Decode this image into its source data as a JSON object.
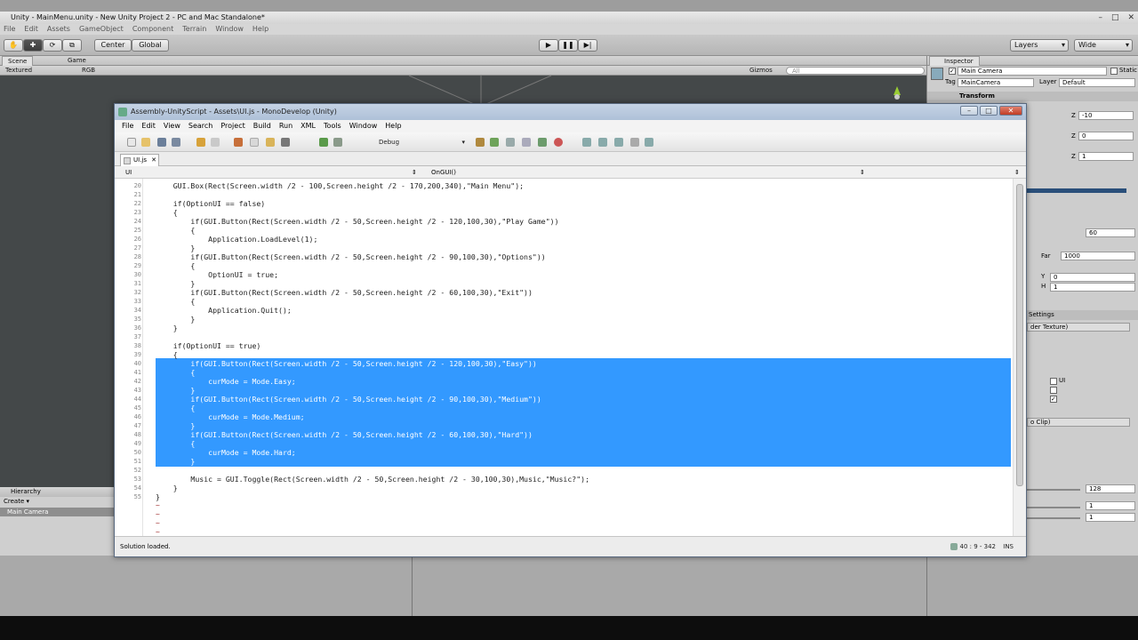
{
  "unity": {
    "window_title": "Unity - MainMenu.unity - New Unity Project 2 - PC and Mac Standalone*",
    "menu": [
      "File",
      "Edit",
      "Assets",
      "GameObject",
      "Component",
      "Terrain",
      "Window",
      "Help"
    ],
    "toolbar": {
      "center": "Center",
      "global": "Global",
      "layers": "Layers",
      "layout": "Wide"
    },
    "scene_tab": "Scene",
    "game_tab": "Game",
    "scene_mode": "Textured",
    "scene_color": "RGB",
    "gizmos": "Gizmos",
    "search_placeholder": "All",
    "hierarchy": {
      "title": "Hierarchy",
      "create": "Create",
      "items": [
        "Main Camera"
      ]
    },
    "inspector": {
      "title": "Inspector",
      "object_name": "Main Camera",
      "static_label": "Static",
      "tag_label": "Tag",
      "tag_value": "MainCamera",
      "layer_label": "Layer",
      "layer_value": "Default",
      "transform": "Transform",
      "z1_label": "Z",
      "z1_value": "-10",
      "z2_label": "Z",
      "z2_value": "0",
      "z3_label": "Z",
      "z3_value": "1",
      "fov_value": "60",
      "far_label": "Far",
      "far_value": "1000",
      "y_label": "Y",
      "y_value": "0",
      "h_label": "H",
      "h_value": "1",
      "settings_label": "Settings",
      "texture_label": "der Texture)",
      "ui_label": "UI",
      "clip_label": "o Clip)",
      "val_128": "128",
      "val_1a": "1",
      "val_1b": "1"
    }
  },
  "monodevelop": {
    "title": "Assembly-UnityScript - Assets\\UI.js - MonoDevelop (Unity)",
    "menu": [
      "File",
      "Edit",
      "View",
      "Search",
      "Project",
      "Build",
      "Run",
      "XML",
      "Tools",
      "Window",
      "Help"
    ],
    "config": "Debug",
    "doc_tab": "UI.js",
    "path_left": "UI",
    "path_right": "OnGUI()",
    "status": "Solution loaded.",
    "cursor_pos": "40 : 9 - 342",
    "insert_mode": "INS",
    "code_lines": [
      {
        "n": "20",
        "text": "    GUI.Box(Rect(Screen.width /2 - 100,Screen.height /2 - 170,200,340),\"Main Menu\");"
      },
      {
        "n": "21",
        "text": ""
      },
      {
        "n": "22",
        "text": "    if(OptionUI == false)"
      },
      {
        "n": "23",
        "text": "    {"
      },
      {
        "n": "24",
        "text": "        if(GUI.Button(Rect(Screen.width /2 - 50,Screen.height /2 - 120,100,30),\"Play Game\"))"
      },
      {
        "n": "25",
        "text": "        {"
      },
      {
        "n": "26",
        "text": "            Application.LoadLevel(1);"
      },
      {
        "n": "27",
        "text": "        }"
      },
      {
        "n": "28",
        "text": "        if(GUI.Button(Rect(Screen.width /2 - 50,Screen.height /2 - 90,100,30),\"Options\"))"
      },
      {
        "n": "29",
        "text": "        {"
      },
      {
        "n": "30",
        "text": "            OptionUI = true;"
      },
      {
        "n": "31",
        "text": "        }"
      },
      {
        "n": "32",
        "text": "        if(GUI.Button(Rect(Screen.width /2 - 50,Screen.height /2 - 60,100,30),\"Exit\"))"
      },
      {
        "n": "33",
        "text": "        {"
      },
      {
        "n": "34",
        "text": "            Application.Quit();"
      },
      {
        "n": "35",
        "text": "        }"
      },
      {
        "n": "36",
        "text": "    }"
      },
      {
        "n": "37",
        "text": ""
      },
      {
        "n": "38",
        "text": "    if(OptionUI == true)"
      },
      {
        "n": "39",
        "text": "    {"
      },
      {
        "n": "40",
        "text": "        if(GUI.Button(Rect(Screen.width /2 - 50,Screen.height /2 - 120,100,30),\"Easy\"))"
      },
      {
        "n": "41",
        "text": "        {"
      },
      {
        "n": "42",
        "text": "            curMode = Mode.Easy;"
      },
      {
        "n": "43",
        "text": "        }"
      },
      {
        "n": "44",
        "text": "        if(GUI.Button(Rect(Screen.width /2 - 50,Screen.height /2 - 90,100,30),\"Medium\"))"
      },
      {
        "n": "45",
        "text": "        {"
      },
      {
        "n": "46",
        "text": "            curMode = Mode.Medium;"
      },
      {
        "n": "47",
        "text": "        }"
      },
      {
        "n": "48",
        "text": "        if(GUI.Button(Rect(Screen.width /2 - 50,Screen.height /2 - 60,100,30),\"Hard\"))"
      },
      {
        "n": "49",
        "text": "        {"
      },
      {
        "n": "50",
        "text": "            curMode = Mode.Hard;"
      },
      {
        "n": "51",
        "text": "        }"
      },
      {
        "n": "52",
        "text": ""
      },
      {
        "n": "53",
        "text": "        Music = GUI.Toggle(Rect(Screen.width /2 - 50,Screen.height /2 - 30,100,30),Music,\"Music?\");"
      },
      {
        "n": "54",
        "text": "    }"
      },
      {
        "n": "55",
        "text": "}"
      }
    ],
    "selection": {
      "from_line": "40",
      "to_line": "51"
    },
    "selection_color": "#3399ff"
  }
}
